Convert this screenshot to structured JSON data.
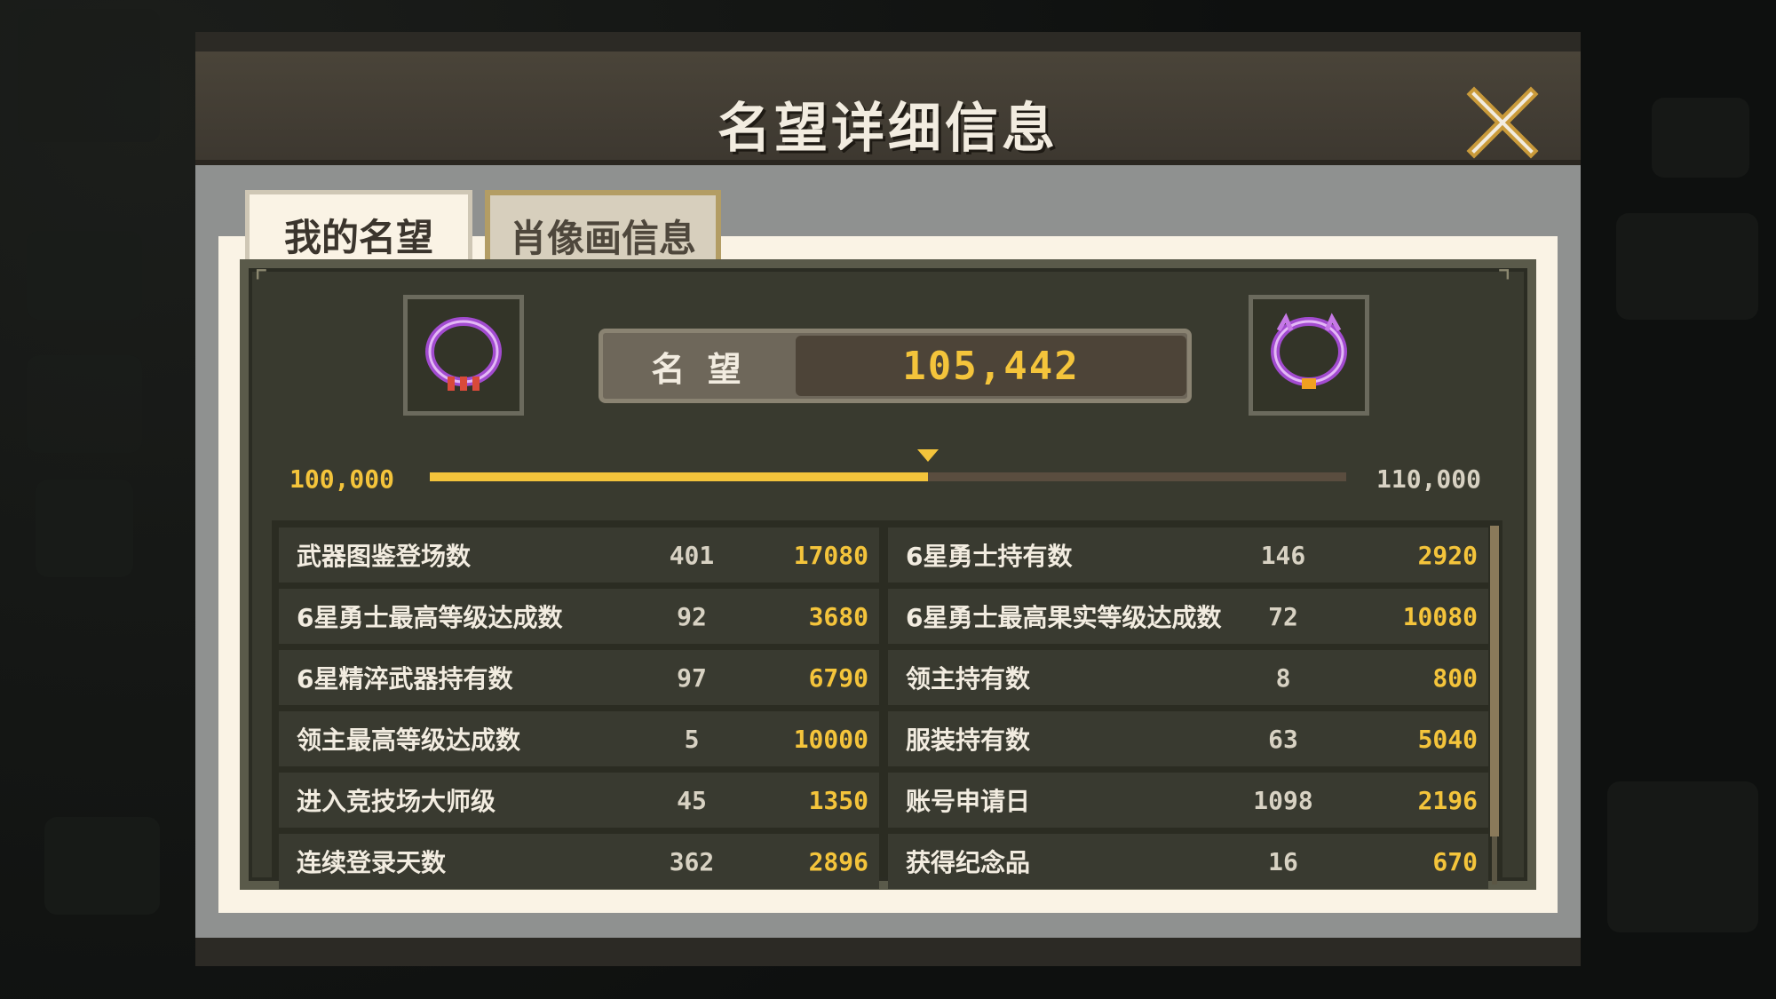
{
  "dialog": {
    "title": "名望详细信息"
  },
  "tabs": [
    {
      "label": "我的名望",
      "active": true
    },
    {
      "label": "肖像画信息",
      "active": false
    }
  ],
  "fame": {
    "label": "名 望",
    "value": "105,442",
    "range_min": "100,000",
    "range_max": "110,000",
    "progress_fraction": 0.544
  },
  "stats_left": [
    {
      "name": "武器图鉴登场数",
      "count": "401",
      "points": "17080"
    },
    {
      "name": "6星勇士最高等级达成数",
      "count": "92",
      "points": "3680"
    },
    {
      "name": "6星精淬武器持有数",
      "count": "97",
      "points": "6790"
    },
    {
      "name": "领主最高等级达成数",
      "count": "5",
      "points": "10000"
    },
    {
      "name": "进入竞技场大师级",
      "count": "45",
      "points": "1350"
    },
    {
      "name": "连续登录天数",
      "count": "362",
      "points": "2896"
    }
  ],
  "stats_right": [
    {
      "name": "6星勇士持有数",
      "count": "146",
      "points": "2920"
    },
    {
      "name": "6星勇士最高果实等级达成数",
      "count": "72",
      "points": "10080"
    },
    {
      "name": "领主持有数",
      "count": "8",
      "points": "800"
    },
    {
      "name": "服装持有数",
      "count": "63",
      "points": "5040"
    },
    {
      "name": "账号申请日",
      "count": "1098",
      "points": "2196"
    },
    {
      "name": "获得纪念品",
      "count": "16",
      "points": "670"
    }
  ],
  "colors": {
    "accent_yellow": "#f4c43b",
    "panel_dark": "#393a2f",
    "cream": "#faf3e5",
    "emblem_purple": "#a24bd0"
  },
  "icons": [
    "close-icon",
    "emblem-frame-icon"
  ]
}
